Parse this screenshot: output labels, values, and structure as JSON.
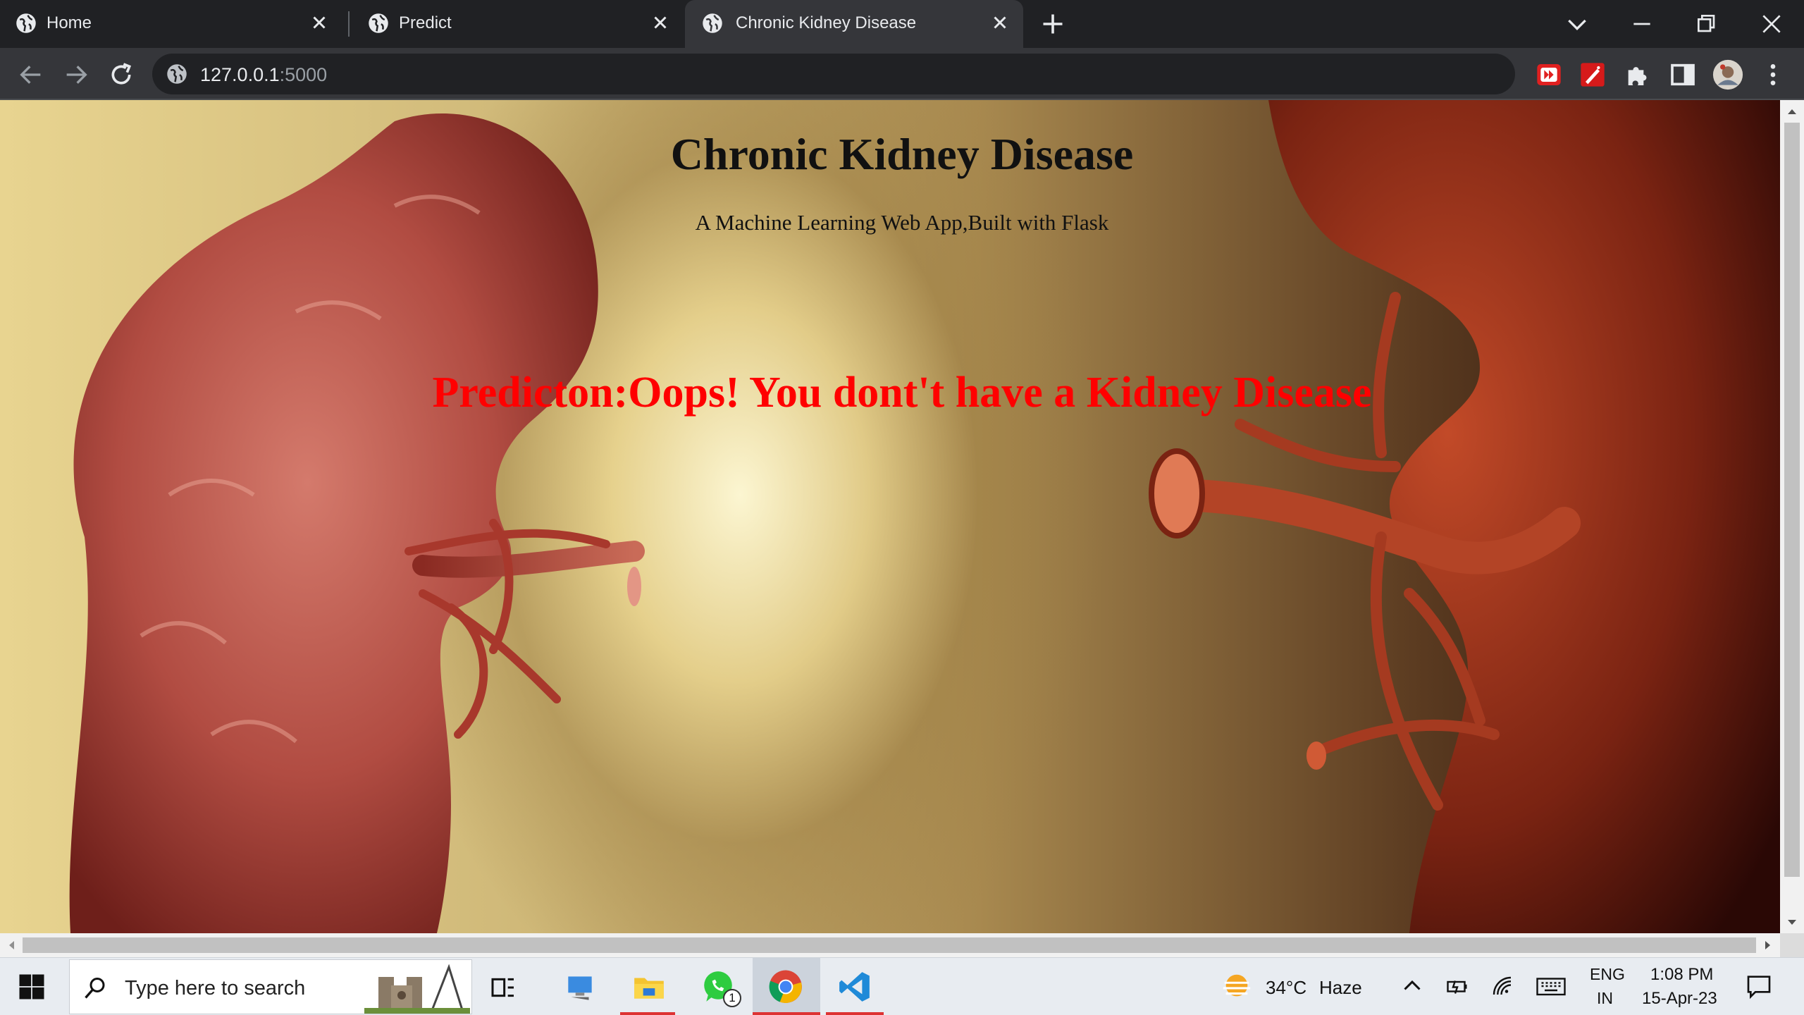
{
  "browser": {
    "tabs": [
      {
        "label": "Home",
        "active": false
      },
      {
        "label": "Predict",
        "active": false
      },
      {
        "label": "Chronic Kidney Disease",
        "active": true
      }
    ],
    "url_host": "127.0.0.1",
    "url_port": ":5000",
    "colors": {
      "tabstrip": "#202124",
      "toolbar": "#35363a",
      "omnibox": "#202124"
    }
  },
  "page": {
    "heading": "Chronic Kidney Disease",
    "subtitle": "A Machine Learning Web App,Built with Flask",
    "prediction": "Predicton:Oops! You dont't have a Kidney Disease",
    "prediction_color": "#ff0000"
  },
  "taskbar": {
    "search_placeholder": "Type here to search",
    "whatsapp_badge": "1",
    "weather_temp": "34°C",
    "weather_desc": "Haze",
    "language_line1": "ENG",
    "language_line2": "IN",
    "time": "1:08 PM",
    "date": "15-Apr-23"
  },
  "icons": {
    "tab_favicon": "globe-icon",
    "nav": [
      "back-arrow-icon",
      "forward-arrow-icon",
      "reload-icon"
    ],
    "extensions": [
      "red-forward-extension-icon",
      "red-pen-extension-icon",
      "puzzle-icon",
      "side-panel-icon",
      "profile-avatar",
      "kebab-menu-icon"
    ]
  }
}
